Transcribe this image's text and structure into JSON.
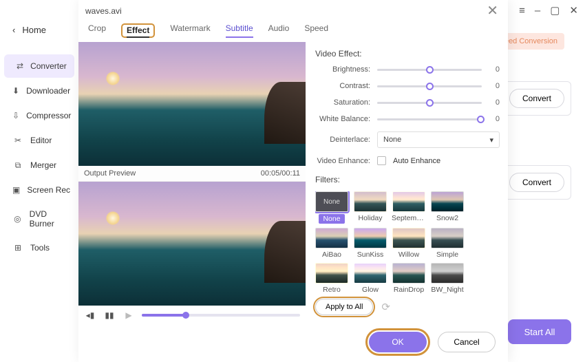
{
  "window": {
    "menu_icon": "≡",
    "minimize": "–",
    "maximize": "▢",
    "close": "✕"
  },
  "home_label": "Home",
  "sidebar": {
    "items": [
      {
        "label": "Converter"
      },
      {
        "label": "Downloader"
      },
      {
        "label": "Compressor"
      },
      {
        "label": "Editor"
      },
      {
        "label": "Merger"
      },
      {
        "label": "Screen Recorder"
      },
      {
        "label": "DVD Burner"
      },
      {
        "label": "Tools"
      }
    ]
  },
  "bg": {
    "speed_pill": "speed Conversion",
    "convert": "Convert",
    "start_all": "Start All"
  },
  "dialog": {
    "title": "waves.avi",
    "close": "✕",
    "tabs": {
      "crop": "Crop",
      "effect": "Effect",
      "watermark": "Watermark",
      "subtitle": "Subtitle",
      "audio": "Audio",
      "speed": "Speed"
    },
    "output_preview": "Output Preview",
    "timecode": "00:05/00:11",
    "video_effect": "Video Effect:",
    "sliders": {
      "brightness": {
        "label": "Brightness:",
        "value": "0"
      },
      "contrast": {
        "label": "Contrast:",
        "value": "0"
      },
      "saturation": {
        "label": "Saturation:",
        "value": "0"
      },
      "white_balance": {
        "label": "White Balance:",
        "value": "0"
      }
    },
    "deinterlace": {
      "label": "Deinterlace:",
      "value": "None"
    },
    "video_enhance": {
      "label": "Video Enhance:",
      "option": "Auto Enhance"
    },
    "filters_label": "Filters:",
    "filters": [
      {
        "label": "None",
        "selected": true,
        "thumb": "none"
      },
      {
        "label": "Holiday"
      },
      {
        "label": "September"
      },
      {
        "label": "Snow2"
      },
      {
        "label": "AiBao"
      },
      {
        "label": "SunKiss"
      },
      {
        "label": "Willow"
      },
      {
        "label": "Simple"
      },
      {
        "label": "Retro"
      },
      {
        "label": "Glow"
      },
      {
        "label": "RainDrop"
      },
      {
        "label": "BW_Night"
      }
    ],
    "apply_all": "Apply to All",
    "ok": "OK",
    "cancel": "Cancel"
  }
}
